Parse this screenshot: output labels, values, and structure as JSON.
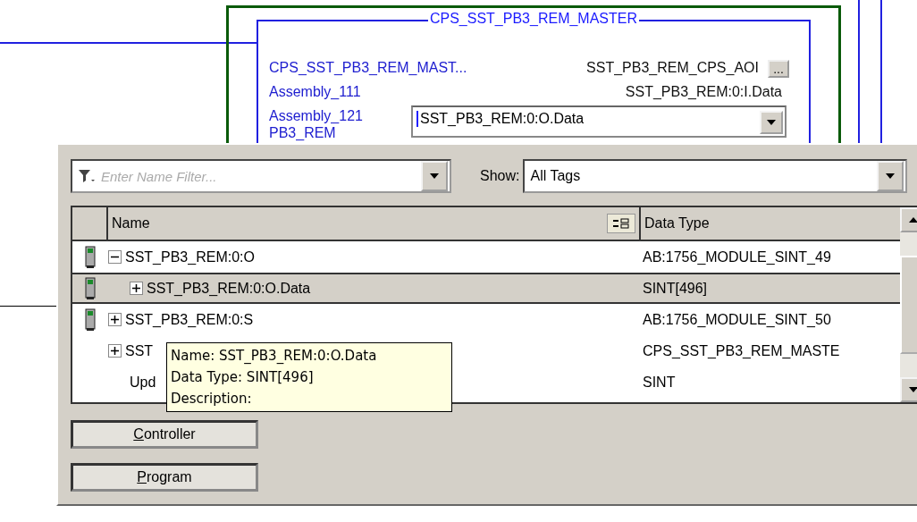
{
  "ladder": {
    "instruction_title": "CPS_SST_PB3_REM_MASTER",
    "rows": [
      {
        "parameter": "CPS_SST_PB3_REM_MAST...",
        "value": "SST_PB3_REM_CPS_AOI",
        "kind": "browse",
        "button": "..."
      },
      {
        "parameter": "Assembly_111",
        "value": "SST_PB3_REM:0:I.Data",
        "kind": "text"
      },
      {
        "parameter": "Assembly_121",
        "value": "SST_PB3_REM:0:O.Data",
        "kind": "editor"
      },
      {
        "parameter": "PB3_REM",
        "kind": "none"
      }
    ]
  },
  "tag_browser": {
    "filter": {
      "placeholder": "Enter Name Filter..."
    },
    "show_label": "Show:",
    "show_value": "All Tags",
    "columns": [
      "Name",
      "Data Type"
    ],
    "tags": [
      {
        "name": "SST_PB3_REM:0:O",
        "data_type": "AB:1756_MODULE_SINT_49",
        "kind": "module",
        "expanded": true,
        "selected": false,
        "children": [
          {
            "name": "SST_PB3_REM:0:O.Data",
            "data_type": "SINT[496]",
            "kind": "module",
            "expanded": false,
            "selected": true
          }
        ]
      },
      {
        "name": "SST_PB3_REM:0:S",
        "data_type": "AB:1756_MODULE_SINT_50",
        "kind": "module",
        "expanded": false,
        "selected": false
      },
      {
        "name": "SST",
        "data_type": "CPS_SST_PB3_REM_MASTE",
        "kind": "struct",
        "expanded": false,
        "selected": false
      },
      {
        "name": "Upd",
        "data_type": "SINT",
        "kind": "atomic",
        "selected": false
      }
    ],
    "tooltip": [
      "Name: SST_PB3_REM:0:O.Data",
      "Data Type: SINT[496]",
      "Description:"
    ],
    "scope_buttons": [
      "Controller",
      "Program"
    ]
  }
}
